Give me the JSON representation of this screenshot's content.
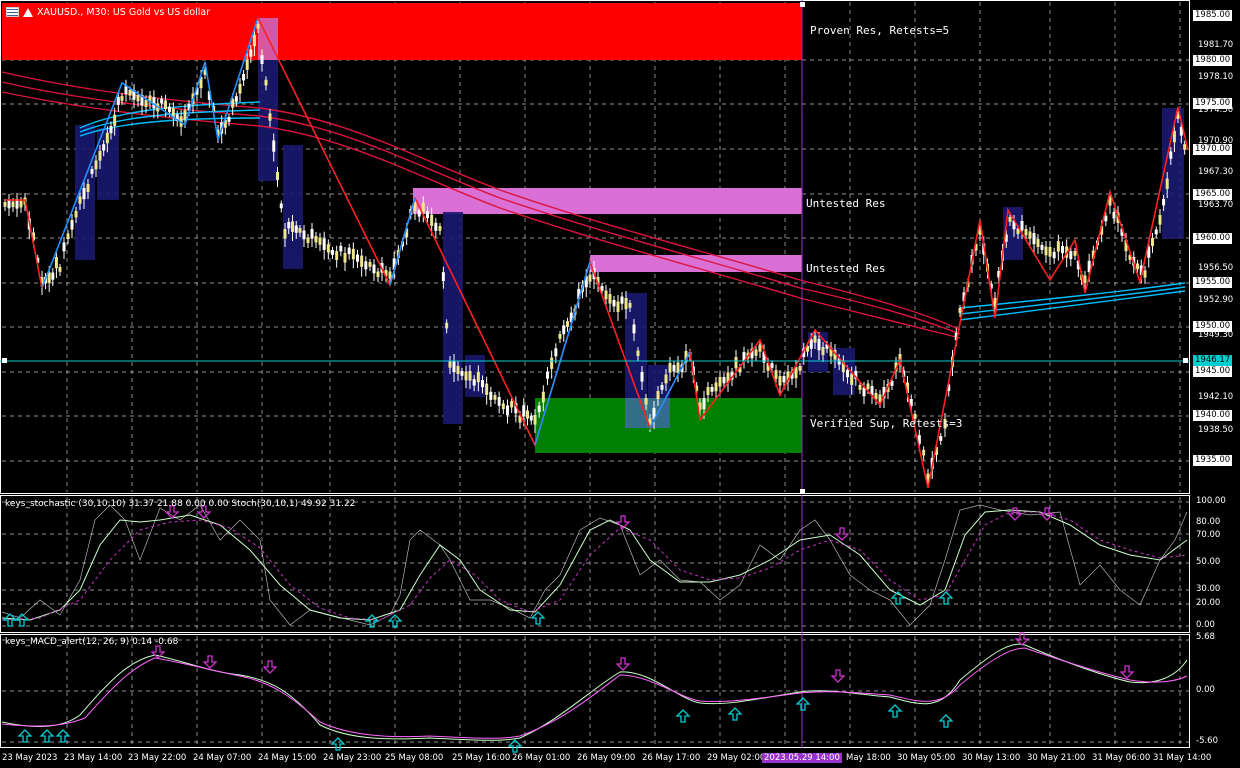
{
  "chart_header": {
    "symbol_text": "XAUUSD., M30:  US Gold vs US dollar",
    "menu_icon": "window-menu-icon",
    "symbol_icon": "symbol-arrow-icon"
  },
  "colors": {
    "background": "#000000",
    "grid": "#c0c0c0",
    "bull_candle": "#ffffff",
    "bear_candle": "#ffffff",
    "proven_res": "#ff0000",
    "untested_res": "#da70d6",
    "verified_sup": "#008000",
    "zigzag_up": "#1e90ff",
    "zigzag_down": "#ff2020",
    "ma_red": "#dc143c",
    "ma_blue": "#00bfff",
    "highlight_bar": "#191970",
    "crosshair_vertical": "#9932cc",
    "current_price_line": "#00ced1",
    "arrow_up": "#00ced1",
    "arrow_down": "#cc33cc"
  },
  "zones": {
    "proven_res_label": "Proven Res, Retests=5",
    "untested_res_1_label": "Untested Res",
    "untested_res_2_label": "Untested Res",
    "verified_sup_label": "Verified Sup, Retests=3"
  },
  "price_axis": {
    "ticks": [
      "1985.00",
      "1981.70",
      "1980.00",
      "1978.10",
      "1975.00",
      "1974.50",
      "1970.90",
      "1970.00",
      "1967.30",
      "1965.00",
      "1963.70",
      "1960.00",
      "1956.50",
      "1955.00",
      "1952.90",
      "1950.00",
      "1949.30",
      "1946.17",
      "1945.00",
      "1942.10",
      "1940.00",
      "1938.50",
      "1935.00"
    ],
    "boxed_ticks": [
      "1985.00",
      "1980.00",
      "1975.00",
      "1970.00",
      "1965.00",
      "1960.00",
      "1955.00",
      "1950.00",
      "1945.00",
      "1940.00",
      "1935.00"
    ],
    "current_price": "1946.17"
  },
  "stochastic": {
    "title": "keys_stochastic (30,10,10) 31.37 21.88 0.00 0.00 Stoch(30,10,1) 49.92 31.22",
    "levels": [
      "100.00",
      "80.00",
      "70.00",
      "50.00",
      "30.00",
      "20.00",
      "0.00"
    ]
  },
  "macd": {
    "title": "keys_MACD_alert(12, 26, 9) 0.14 -0.68",
    "levels": [
      "5.68",
      "0.00",
      "-5.60"
    ]
  },
  "time_axis": {
    "labels": [
      "23 May 2023",
      "23 May 14:00",
      "23 May 22:00",
      "24 May 07:00",
      "24 May 15:00",
      "24 May 23:00",
      "25 May 08:00",
      "25 May 16:00",
      "26 May 01:00",
      "26 May 09:00",
      "26 May 17:00",
      "29 May 02:00",
      "2023.05.29 14:00",
      "May 18:00",
      "30 May 05:00",
      "30 May 13:00",
      "30 May 21:00",
      "31 May 06:00",
      "31 May 14:00"
    ],
    "crosshair_label": "2023.05.29 14:00"
  }
}
